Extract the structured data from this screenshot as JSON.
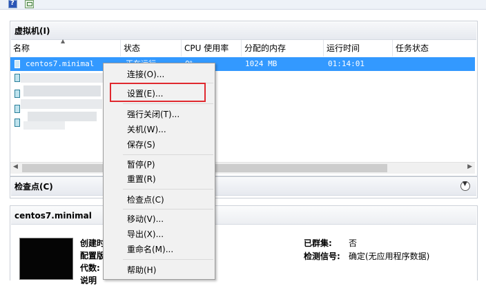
{
  "toolbar": {
    "help_label": "?"
  },
  "vm_panel": {
    "title": "虚拟机(I)",
    "columns": [
      "名称",
      "状态",
      "CPU 使用率",
      "分配的内存",
      "运行时间",
      "任务状态"
    ],
    "rows": [
      {
        "name": "centos7.minimal",
        "state": "正在运行",
        "cpu": "0%",
        "memory": "1024 MB",
        "uptime": "01:14:01",
        "task": ""
      }
    ]
  },
  "checkpoint_panel": {
    "title": "检查点(C)"
  },
  "details_panel": {
    "title": "centos7.minimal",
    "left_labels": [
      "创建时",
      "配置版",
      "代数:",
      "说明"
    ],
    "right_items": [
      {
        "label": "已群集:",
        "value": "否"
      },
      {
        "label": "检测信号:",
        "value": "确定(无应用程序数据)"
      }
    ]
  },
  "context_menu": {
    "items": [
      "连接(O)...",
      "设置(E)...",
      "强行关闭(T)...",
      "关机(W)...",
      "保存(S)",
      "暂停(P)",
      "重置(R)",
      "检查点(C)",
      "移动(V)...",
      "导出(X)...",
      "重命名(M)...",
      "帮助(H)"
    ],
    "highlighted": "设置(E)..."
  },
  "colors": {
    "selection": "#3399ff",
    "highlight_box": "#e0282e"
  }
}
